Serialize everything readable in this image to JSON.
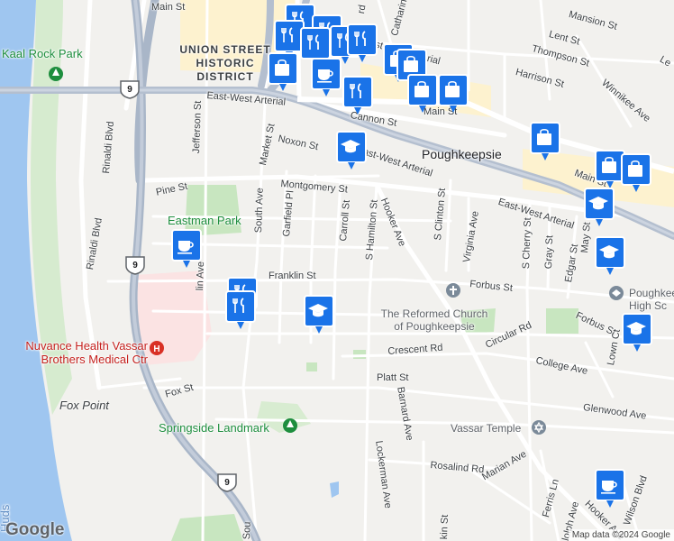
{
  "map": {
    "attribution": "Map data ©2024 Google",
    "logo": "Google",
    "colors": {
      "land": "#f2f1ee",
      "water": "#9fc6f0",
      "park": "#c8e6c0",
      "hospital": "#fbe3e3",
      "highway": "#a9b6c8",
      "arterial": "#b4bfcf",
      "road": "#ffffff",
      "district": "#fdf2cf",
      "pin_fill": "#1a73e8",
      "pin_glyph": "#ffffff"
    },
    "places": {
      "union_district": "UNION STREET\nHISTORIC\nDISTRICT",
      "poughkeepsie": "Poughkeepsie",
      "eastman_park": "Eastman Park",
      "kaal_rock_park": "Kaal Rock Park",
      "hospital": "Nuvance Health Vassar\nBrothers Medical Ctr",
      "fox_point": "Fox Point",
      "springside": "Springside Landmark",
      "church": "The Reformed Church\nof Poughkeepsie",
      "vassar_temple": "Vassar Temple",
      "high_school": "Poughkeep\nHigh Sc",
      "hudson": "Huds"
    },
    "streets": {
      "main_st_1": "Main St",
      "main_st_2": "Main St",
      "main_st_3": "Main St",
      "east_west_1": "East-West Arterial",
      "east_west_2": "East-West Arterial",
      "east_west_3": "East-West Arterial",
      "east_west_4": "East-West Arterial",
      "cannon_st": "Cannon St",
      "noxon_st": "Noxon St",
      "montgomery_st": "Montgomery St",
      "pine_st": "Pine St",
      "franklin_st": "Franklin St",
      "forbus_st_1": "Forbus St",
      "forbus_st_2": "Forbus St",
      "crescent_rd": "Crescent Rd",
      "circular_rd": "Circular Rd",
      "college_ave": "College Ave",
      "platt_st": "Platt St",
      "glenwood_ave": "Glenwood Ave",
      "fox_st": "Fox St",
      "rosalind_rd": "Rosalind Rd",
      "marian_ave": "Marian Ave",
      "barnard_ave": "Barnard Ave",
      "lockerman_ave": "Lockerman Ave",
      "hooker_ave_1": "Hooker Ave",
      "hooker_ave_2": "Hooker Ave",
      "s_hamilton_st": "S Hamilton St",
      "carroll_st": "Carroll St",
      "garfield_pl": "Garfield Pl",
      "south_ave": "South Ave",
      "market_st": "Market St",
      "jefferson_st": "Jefferson St",
      "rinaldi_blvd_1": "Rinaldi Blvd",
      "rinaldi_blvd_2": "Rinaldi Blvd",
      "s_clinton_st": "S Clinton St",
      "virginia_ave": "Virginia Ave",
      "s_cherry_st": "S Cherry St",
      "gray_st": "Gray St",
      "edgar_st": "Edgar St",
      "may_st": "May St",
      "lown_ct": "Lown Ct",
      "wilson_blvd": "Wilson Blvd",
      "mansion_st": "Mansion St",
      "lent_st": "Lent St",
      "thompson_st": "Thompson St",
      "harrison_st": "Harrison St",
      "winnikee_ave": "Winnikee Ave",
      "catharine_st": "Catharine",
      "ferris_ln": "Ferris Ln",
      "n_ave": "lin Ave",
      "n_st": "kin St",
      "randolph": "lolph Ave",
      "south_cut": "Sou",
      "le": "Le",
      "rd": "rd"
    },
    "shields": [
      "9",
      "9",
      "9"
    ],
    "markers": [
      {
        "icon": "restaurant-icon"
      },
      {
        "icon": "restaurant-icon"
      },
      {
        "icon": "restaurant-icon"
      },
      {
        "icon": "restaurant-icon"
      },
      {
        "icon": "restaurant-icon"
      },
      {
        "icon": "restaurant-icon"
      },
      {
        "icon": "restaurant-icon"
      },
      {
        "icon": "restaurant-icon"
      },
      {
        "icon": "restaurant-icon"
      },
      {
        "icon": "shopping-bag-icon"
      },
      {
        "icon": "shopping-bag-icon"
      },
      {
        "icon": "shopping-bag-icon"
      },
      {
        "icon": "shopping-bag-icon"
      },
      {
        "icon": "shopping-bag-icon"
      },
      {
        "icon": "shopping-bag-icon"
      },
      {
        "icon": "shopping-bag-icon"
      },
      {
        "icon": "shopping-bag-icon"
      },
      {
        "icon": "cafe-icon"
      },
      {
        "icon": "cafe-icon"
      },
      {
        "icon": "cafe-icon"
      },
      {
        "icon": "school-icon"
      },
      {
        "icon": "school-icon"
      },
      {
        "icon": "school-icon"
      },
      {
        "icon": "school-icon"
      },
      {
        "icon": "school-icon"
      }
    ]
  }
}
